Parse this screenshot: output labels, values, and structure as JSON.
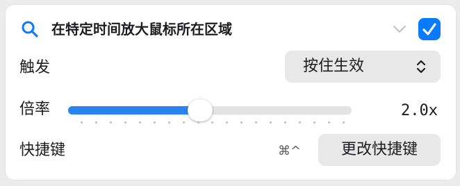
{
  "header": {
    "title": "在特定时间放大鼠标所在区域",
    "enabled": true
  },
  "trigger": {
    "label": "触发",
    "selected": "按住生效"
  },
  "magnification": {
    "label": "倍率",
    "value_text": "2.0x",
    "value": 2.0,
    "slider_fraction": 0.45,
    "tick_count": 19
  },
  "shortcut": {
    "label": "快捷键",
    "keys": "⌘^",
    "change_label": "更改快捷键"
  },
  "colors": {
    "accent": "#0a7aff",
    "slider_fill": "#2a83f1"
  }
}
